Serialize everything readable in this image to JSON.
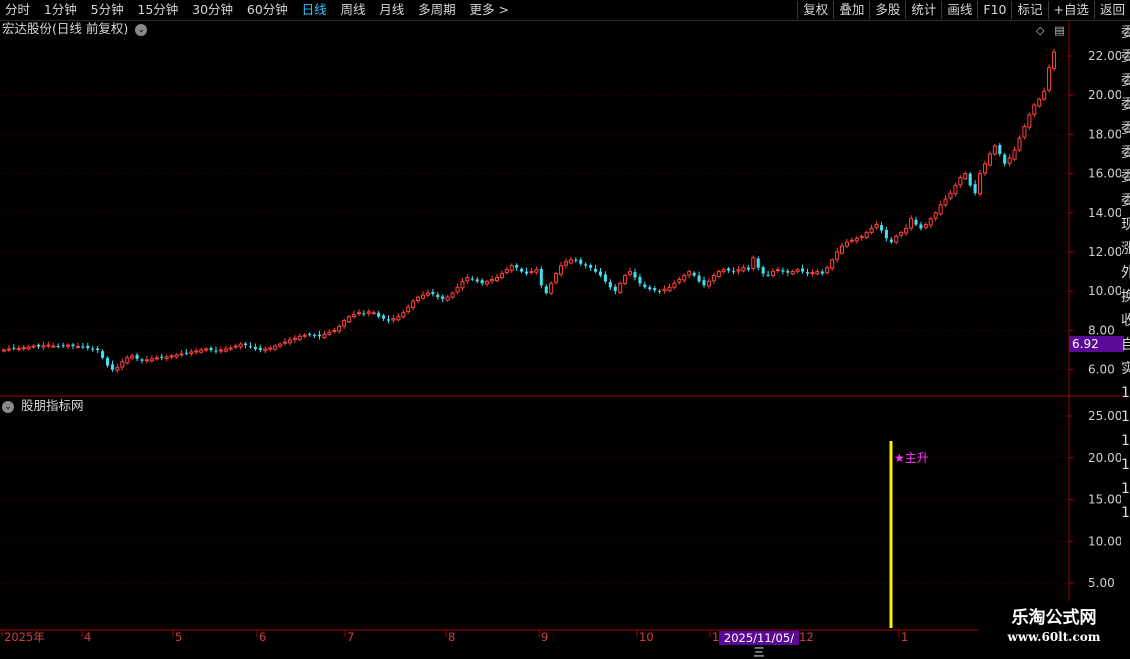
{
  "toolbar": {
    "periods": [
      {
        "label": "分时"
      },
      {
        "label": "1分钟"
      },
      {
        "label": "5分钟"
      },
      {
        "label": "15分钟"
      },
      {
        "label": "30分钟"
      },
      {
        "label": "60分钟"
      },
      {
        "label": "日线",
        "active": true
      },
      {
        "label": "周线"
      },
      {
        "label": "月线"
      },
      {
        "label": "多周期"
      },
      {
        "label": "更多 >"
      }
    ],
    "actions": [
      "复权",
      "叠加",
      "多股",
      "统计",
      "画线",
      "F10",
      "标记",
      "+自选",
      "返回"
    ]
  },
  "chart_title": "宏达股份(日线 前复权)",
  "indicator_title": "股朋指标网",
  "price_tag": "6.92",
  "date_tag": "2025/11/05/三",
  "signal_label": "★主升",
  "watermark": {
    "line1": "乐淘公式网",
    "line2": "www.60lt.com"
  },
  "colors": {
    "up": "#ff4040",
    "down": "#40e0f0",
    "grid": "#3a0000",
    "axis": "#aa0000",
    "signal": "#ffee00",
    "label": "#ff33ff"
  },
  "price_axis": {
    "ticks": [
      "22.00",
      "20.00",
      "18.00",
      "16.00",
      "14.00",
      "12.00",
      "10.00",
      "8.00",
      "6.00"
    ]
  },
  "indicator_axis": {
    "ticks": [
      "25.00",
      "20.00",
      "15.00",
      "10.00",
      "5.00"
    ]
  },
  "x_axis": {
    "labels": [
      "2025年",
      "4",
      "5",
      "6",
      "7",
      "8",
      "9",
      "10",
      "11",
      "12",
      "1"
    ]
  },
  "side_strip": [
    "委",
    "委",
    "委",
    "委",
    "委",
    "委",
    "委",
    "委",
    "现",
    "涨",
    "外",
    "换",
    "收",
    "自",
    "实",
    "1",
    "1",
    "1",
    "1",
    "1",
    "1"
  ],
  "chart_data": [
    {
      "type": "candlestick",
      "title": "宏达股份(日线 前复权)",
      "ylim": [
        5.3,
        23.8
      ],
      "yticks": [
        6,
        8,
        10,
        12,
        14,
        16,
        18,
        20,
        22
      ],
      "x_month_labels": [
        "2025年",
        "4",
        "5",
        "6",
        "7",
        "8",
        "9",
        "10",
        "11",
        "12",
        "1"
      ],
      "close_series": [
        7.0,
        7.05,
        7.1,
        7.08,
        7.12,
        7.15,
        7.2,
        7.18,
        7.22,
        7.25,
        7.2,
        7.18,
        7.22,
        7.25,
        7.2,
        7.18,
        7.15,
        7.1,
        7.05,
        7.0,
        6.6,
        6.2,
        6.0,
        6.1,
        6.4,
        6.6,
        6.7,
        6.55,
        6.45,
        6.5,
        6.55,
        6.6,
        6.6,
        6.65,
        6.7,
        6.75,
        6.8,
        6.85,
        6.9,
        6.95,
        7.0,
        7.05,
        7.0,
        6.95,
        7.0,
        7.05,
        7.1,
        7.2,
        7.3,
        7.25,
        7.15,
        7.05,
        7.0,
        7.05,
        7.1,
        7.2,
        7.3,
        7.4,
        7.5,
        7.6,
        7.7,
        7.75,
        7.8,
        7.75,
        7.7,
        7.8,
        7.9,
        8.0,
        8.2,
        8.5,
        8.7,
        8.8,
        8.9,
        8.85,
        8.95,
        8.9,
        8.7,
        8.6,
        8.5,
        8.6,
        8.7,
        8.9,
        9.2,
        9.5,
        9.7,
        9.8,
        9.9,
        9.85,
        9.7,
        9.6,
        9.7,
        9.9,
        10.2,
        10.5,
        10.7,
        10.6,
        10.5,
        10.4,
        10.5,
        10.6,
        10.7,
        10.9,
        11.1,
        11.3,
        11.2,
        11.0,
        10.9,
        11.0,
        11.1,
        10.3,
        9.9,
        10.4,
        10.9,
        11.3,
        11.5,
        11.6,
        11.55,
        11.4,
        11.3,
        11.2,
        11.0,
        10.8,
        10.5,
        10.2,
        10.0,
        10.4,
        10.8,
        11.0,
        10.7,
        10.4,
        10.2,
        10.1,
        10.05,
        10.0,
        10.1,
        10.2,
        10.4,
        10.6,
        10.8,
        11.0,
        10.8,
        10.5,
        10.3,
        10.5,
        10.8,
        11.0,
        11.1,
        11.05,
        11.0,
        11.1,
        11.2,
        11.1,
        11.7,
        11.2,
        10.9,
        10.8,
        11.0,
        11.1,
        11.0,
        10.95,
        11.0,
        11.1,
        11.0,
        10.9,
        10.95,
        11.0,
        10.9,
        11.2,
        11.6,
        12.0,
        12.3,
        12.5,
        12.6,
        12.7,
        12.8,
        13.0,
        13.2,
        13.4,
        13.1,
        12.7,
        12.5,
        12.8,
        13.0,
        13.2,
        13.7,
        13.4,
        13.2,
        13.4,
        13.7,
        14.0,
        14.4,
        14.7,
        15.0,
        15.4,
        15.8,
        16.0,
        15.4,
        15.0,
        16.0,
        16.5,
        17.0,
        17.4,
        17.0,
        16.5,
        16.8,
        17.2,
        17.8,
        18.4,
        19.0,
        19.5,
        19.8,
        20.2,
        21.4,
        22.2
      ]
    },
    {
      "type": "bar",
      "title": "股朋指标网",
      "ylim": [
        0,
        27
      ],
      "yticks": [
        5,
        10,
        15,
        20,
        25
      ],
      "signals": [
        {
          "date": "2025/11/05",
          "value": 22,
          "label": "★主升"
        }
      ]
    }
  ]
}
